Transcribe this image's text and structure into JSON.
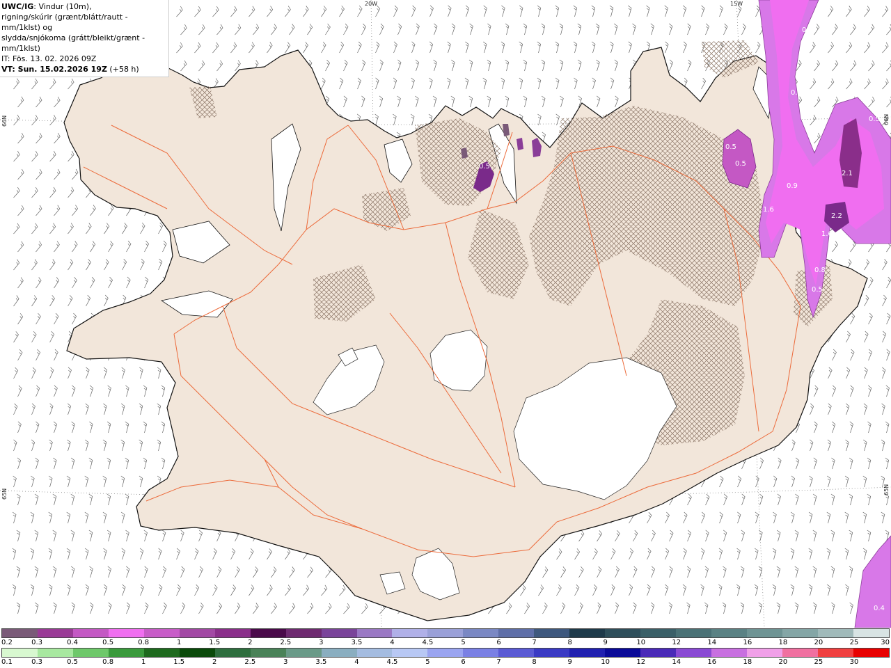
{
  "header": {
    "tag": "UWC/IG",
    "line1": ": Vindur (10m),",
    "line2": "rigning/skúrir (grænt/blátt/rautt - mm/1klst) og",
    "line3": "slydda/snjókoma (grátt/bleikt/grænt - mm/1klst)",
    "it": "IT: Fös. 13. 02. 2026 09Z",
    "vt_bold": "VT: Sun. 15.02.2026 19Z",
    "vt_rest": " (+58 h)"
  },
  "graticule": {
    "lon_20w": "20W",
    "lon_15w": "15W",
    "lat_66n_left": "66N",
    "lat_66n_right": "66N",
    "lat_65n_left": "65N",
    "lat_65n_right": "65N"
  },
  "precip_labels": [
    "0.5",
    "0.9",
    "0.5",
    "0.5",
    "0.5",
    "0.5",
    "2.1",
    "0.9",
    "1.6",
    "2.2",
    "1.6",
    "0.8",
    "0.5",
    "0.4"
  ],
  "legend_snow": {
    "ticks": [
      "0.2",
      "0.3",
      "0.4",
      "0.5",
      "0.8",
      "1",
      "1.5",
      "2",
      "2.5",
      "3",
      "3.5",
      "4",
      "4.5",
      "5",
      "6",
      "7",
      "8",
      "9",
      "10",
      "12",
      "14",
      "16",
      "18",
      "20",
      "25",
      "30"
    ],
    "colors": [
      "#7a5a78",
      "#9a3a96",
      "#c458c4",
      "#f06ef0",
      "#c85cc8",
      "#a248a4",
      "#8a2e8a",
      "#4a0a4a",
      "#6e2a70",
      "#7a449a",
      "#9a78c4",
      "#b0b0e8",
      "#9aa0d8",
      "#7a88c4",
      "#5e6ea8",
      "#3e587e",
      "#1e3a4a",
      "#2e4e5a",
      "#3a6068",
      "#4a7276",
      "#5a8284",
      "#6e9494",
      "#84a6a6",
      "#a0baba",
      "#d8e4e4"
    ]
  },
  "legend_rain": {
    "ticks": [
      "0.1",
      "0.3",
      "0.5",
      "0.8",
      "1",
      "1.5",
      "2",
      "2.5",
      "3",
      "3.5",
      "4",
      "4.5",
      "5",
      "6",
      "7",
      "8",
      "9",
      "10",
      "12",
      "14",
      "16",
      "18",
      "20",
      "25",
      "30"
    ],
    "colors": [
      "#d8f8d0",
      "#a8e8a0",
      "#6ec86a",
      "#3a9a3c",
      "#1e6a1e",
      "#0a4a0a",
      "#2e6e3e",
      "#4a8258",
      "#6a9a88",
      "#8aaec0",
      "#a4bce0",
      "#b8c8f4",
      "#9aa4f0",
      "#7a80e4",
      "#5a5ad4",
      "#3a3ac4",
      "#2020b0",
      "#0a0a98",
      "#4a2ab8",
      "#8a4ad4",
      "#c870e0",
      "#f0a0e8",
      "#f070a0",
      "#f04040",
      "#e80000"
    ]
  },
  "colors": {
    "land": "#f2e6da",
    "roads": "#ec6a3a",
    "glacier": "#ffffff",
    "coast": "#111111",
    "precip_light": "#d878e8",
    "precip_mid": "#b84cc8",
    "precip_heavy": "#7a2a8a",
    "barb": "#666666"
  }
}
